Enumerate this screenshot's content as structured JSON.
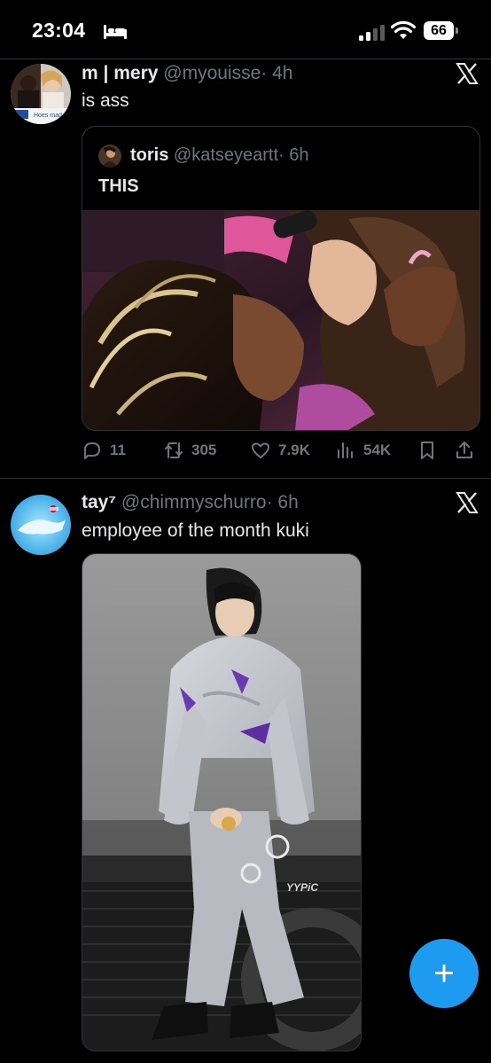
{
  "status_bar": {
    "time": "23:04",
    "battery": "66",
    "icons": [
      "bed-icon",
      "signal-icon",
      "wifi-icon",
      "battery-icon"
    ]
  },
  "tweets": [
    {
      "display_name": "m | mery",
      "handle": "@myouisse",
      "time": "· 4h",
      "text": "is ass",
      "avatar_caption": "Hoes mad",
      "quote": {
        "display_name": "toris",
        "handle": "@katseyeartt",
        "time": "· 6h",
        "text": "THIS"
      },
      "actions": {
        "replies": "11",
        "reposts": "305",
        "likes": "7.9K",
        "views": "54K"
      }
    },
    {
      "display_name": "tay⁷",
      "handle": "@chimmyschurro",
      "time": "· 6h",
      "text": "employee of the month kuki",
      "media_watermark": "YYPiC"
    }
  ],
  "fab": {
    "label": "+"
  },
  "colors": {
    "background": "#000000",
    "text_primary": "#e7e9ea",
    "text_secondary": "#71767b",
    "divider": "#2f3336",
    "accent": "#1d9bf0"
  }
}
